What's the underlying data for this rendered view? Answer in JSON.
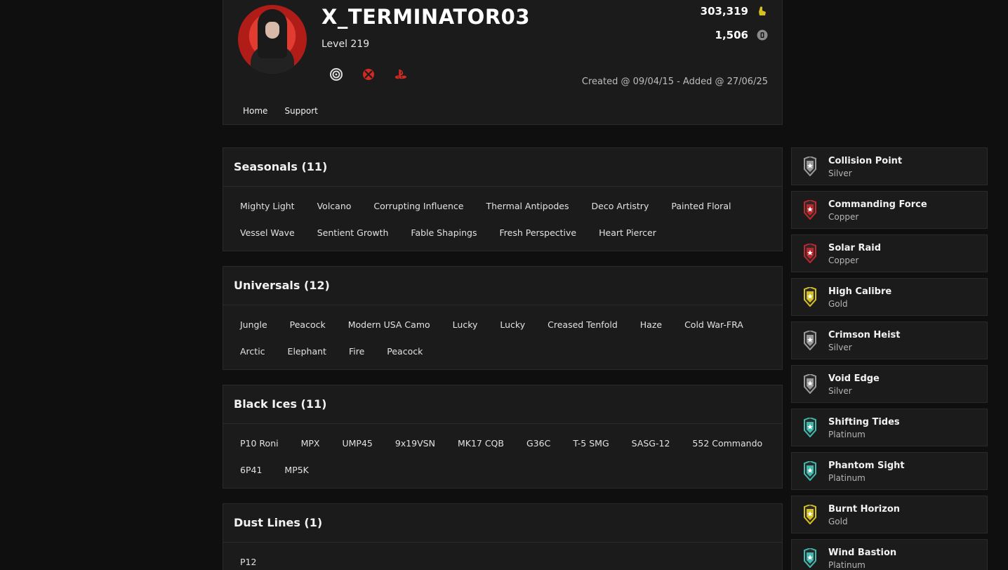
{
  "profile": {
    "username": "X_TERMINATOR03",
    "level": "Level 219",
    "credits": "303,319",
    "credits_icon": "credits-icon",
    "renown": "1,506",
    "renown_icon": "renown-icon",
    "created": "Created @ 09/04/15 - Added @ 27/06/25",
    "platforms": [
      "ubisoft-icon",
      "xbox-icon",
      "playstation-icon"
    ]
  },
  "nav": {
    "home": "Home",
    "support": "Support"
  },
  "sections": [
    {
      "title": "Seasonals (11)",
      "rows": [
        [
          "Mighty Light",
          "Volcano",
          "Corrupting Influence",
          "Thermal Antipodes",
          "Deco Artistry",
          "Painted Floral"
        ],
        [
          "Vessel Wave",
          "Sentient Growth",
          "Fable Shapings",
          "Fresh Perspective",
          "Heart Piercer"
        ]
      ]
    },
    {
      "title": "Universals (12)",
      "rows": [
        [
          "Jungle",
          "Peacock",
          "Modern USA Camo",
          "Lucky",
          "Lucky",
          "Creased Tenfold",
          "Haze",
          "Cold War-FRA"
        ],
        [
          "Arctic",
          "Elephant",
          "Fire",
          "Peacock"
        ]
      ]
    },
    {
      "title": "Black Ices (11)",
      "rows": [
        [
          "P10 Roni",
          "MPX",
          "UMP45",
          "9x19VSN",
          "MK17 CQB",
          "G36C",
          "T-5 SMG",
          "SASG-12",
          "552 Commando"
        ],
        [
          "6P41",
          "MP5K"
        ]
      ]
    },
    {
      "title": "Dust Lines (1)",
      "rows": [
        [
          "P12"
        ]
      ]
    }
  ],
  "ranks": [
    {
      "name": "Collision Point",
      "tier": "Silver",
      "color": "#9a9a9a"
    },
    {
      "name": "Commanding Force",
      "tier": "Copper",
      "color": "#c0262b"
    },
    {
      "name": "Solar Raid",
      "tier": "Copper",
      "color": "#c0262b"
    },
    {
      "name": "High Calibre",
      "tier": "Gold",
      "color": "#d6c020"
    },
    {
      "name": "Crimson Heist",
      "tier": "Silver",
      "color": "#9a9a9a"
    },
    {
      "name": "Void Edge",
      "tier": "Silver",
      "color": "#9a9a9a"
    },
    {
      "name": "Shifting Tides",
      "tier": "Platinum",
      "color": "#3fb8ad"
    },
    {
      "name": "Phantom Sight",
      "tier": "Platinum",
      "color": "#3fb8ad"
    },
    {
      "name": "Burnt Horizon",
      "tier": "Gold",
      "color": "#d6c020"
    },
    {
      "name": "Wind Bastion",
      "tier": "Platinum",
      "color": "#3fb8ad"
    }
  ]
}
